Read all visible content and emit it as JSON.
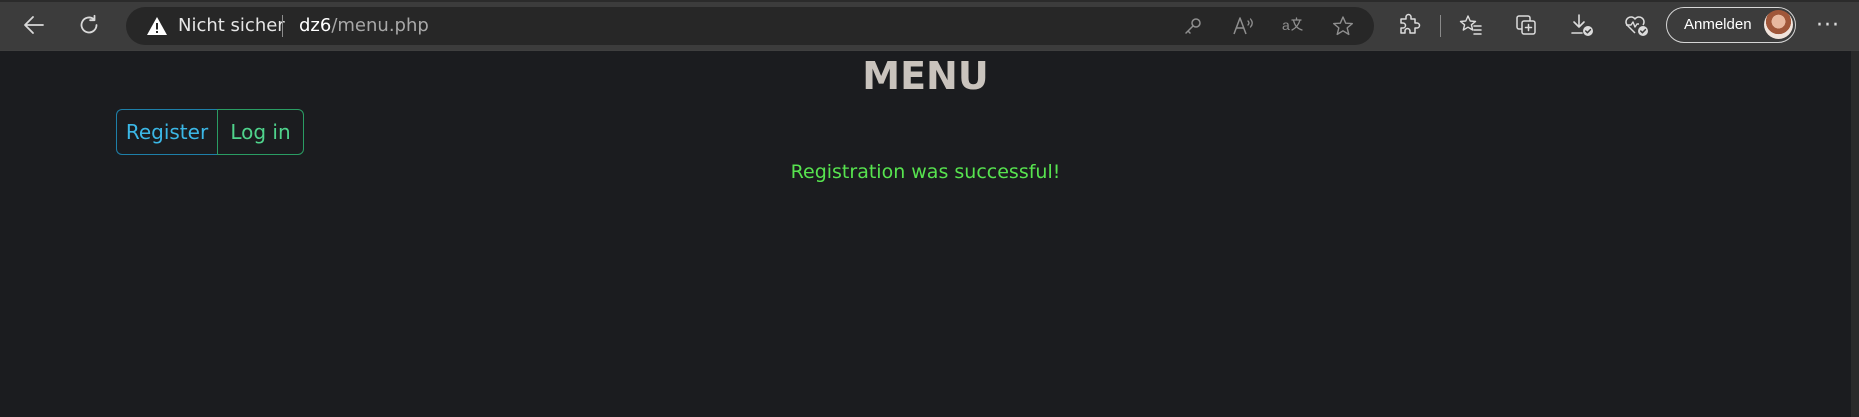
{
  "browser": {
    "security_label": "Nicht sicher",
    "url_host": "dz6",
    "url_path": "/menu.php",
    "signin_label": "Anmelden",
    "icons": [
      "back-icon",
      "refresh-icon",
      "warning-icon",
      "key-icon",
      "read-aloud-icon",
      "translate-icon",
      "favorite-star-icon",
      "extensions-icon",
      "favorites-icon",
      "collections-icon",
      "downloads-icon",
      "browser-health-icon",
      "more-icon"
    ]
  },
  "page": {
    "title": "MENU",
    "register_label": "Register",
    "login_label": "Log in",
    "status_message": "Registration was successful!"
  },
  "colors": {
    "background": "#1b1c1f",
    "title": "#c9c3bd",
    "register": "#3bb7e6",
    "login": "#4fd38c",
    "success": "#57e34f"
  }
}
